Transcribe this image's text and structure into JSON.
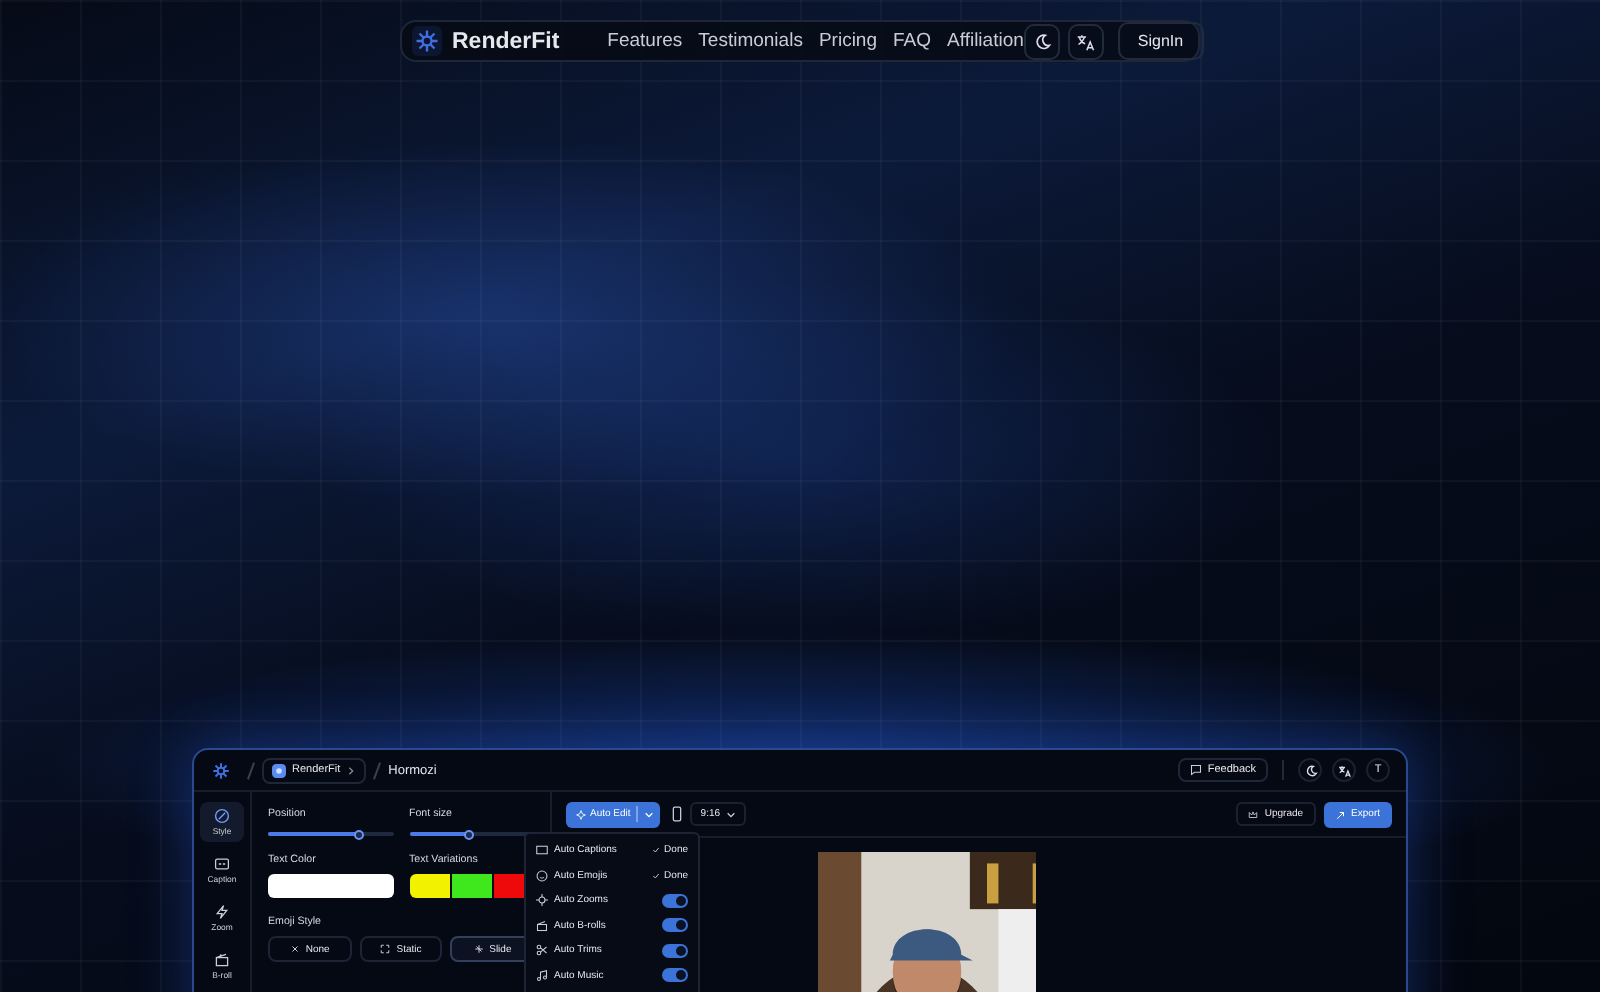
{
  "nav": {
    "brand": "RenderFit",
    "links": [
      "Features",
      "Testimonials",
      "Pricing",
      "FAQ",
      "Affiliation"
    ],
    "signin": "SignIn"
  },
  "app": {
    "workspace": "RenderFit",
    "project": "Hormozi",
    "feedback": "Feedback",
    "avatar": "T",
    "rail": [
      {
        "label": "Style",
        "kind": "style",
        "selected": true
      },
      {
        "label": "Caption",
        "kind": "caption",
        "selected": false
      },
      {
        "label": "Zoom",
        "kind": "zoom",
        "selected": false
      },
      {
        "label": "B-roll",
        "kind": "broll",
        "selected": false
      }
    ],
    "sliders": [
      {
        "label": "Position",
        "level": 0.73
      },
      {
        "label": "Font size",
        "level": 0.48
      }
    ],
    "text_color_label": "Text Color",
    "text_variations_label": "Text Variations",
    "variations": [
      {
        "color": "#f2f200"
      },
      {
        "color": "#3ee81c"
      },
      {
        "color": "#ee0a0a"
      }
    ],
    "emoji_style": {
      "label": "Emoji Style",
      "options": [
        {
          "label": "None",
          "kind": "none",
          "selected": false
        },
        {
          "label": "Static",
          "kind": "static",
          "selected": false
        },
        {
          "label": "Slide",
          "kind": "slide",
          "selected": true
        }
      ]
    },
    "auto_edit": "Auto Edit",
    "aspect": "9:16",
    "upgrade": "Upgrade",
    "export": "Export",
    "auto_menu": [
      {
        "label": "Auto Captions",
        "kind": "captions",
        "status": "Done"
      },
      {
        "label": "Auto Emojis",
        "kind": "emojis",
        "status": "Done"
      },
      {
        "label": "Auto Zooms",
        "kind": "zooms",
        "on": true
      },
      {
        "label": "Auto B-rolls",
        "kind": "brolls",
        "on": true
      },
      {
        "label": "Auto Trims",
        "kind": "trims",
        "on": true
      },
      {
        "label": "Auto Music",
        "kind": "music",
        "on": true
      }
    ]
  }
}
